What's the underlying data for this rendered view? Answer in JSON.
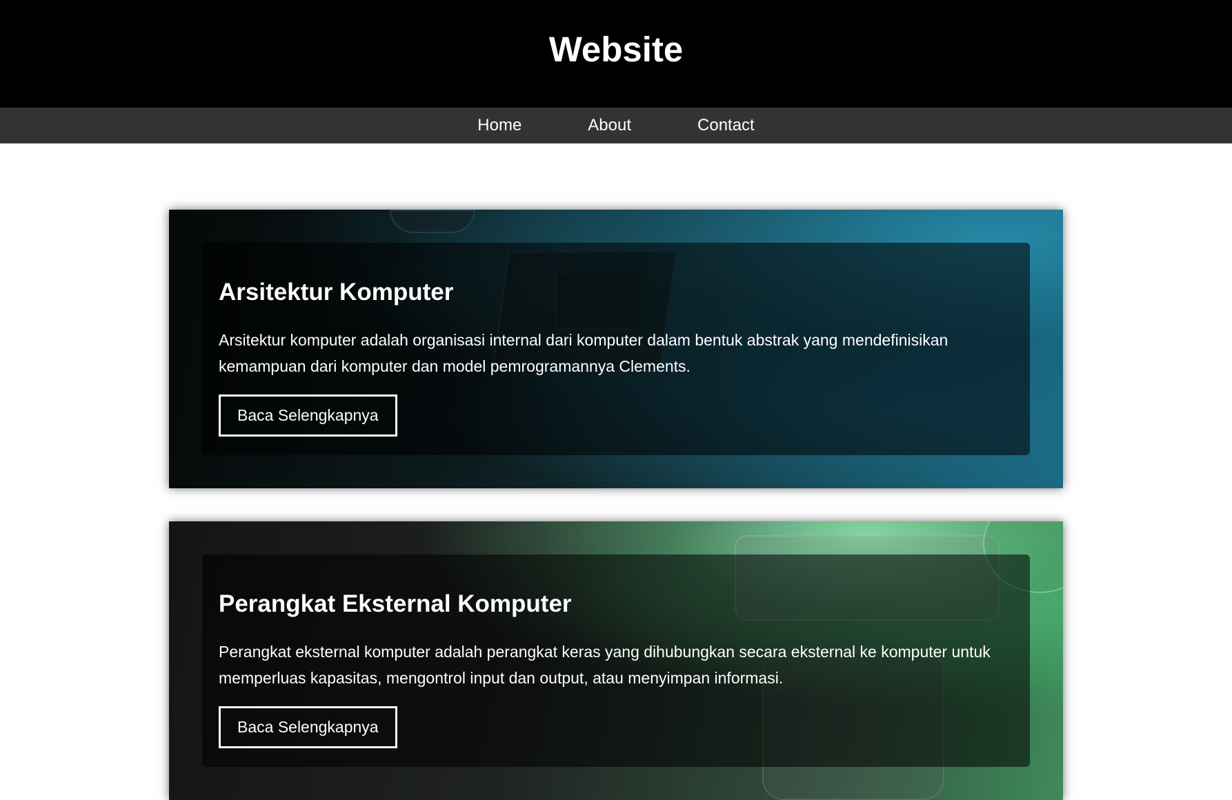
{
  "header": {
    "title": "Website"
  },
  "nav": {
    "items": [
      {
        "label": "Home"
      },
      {
        "label": "About"
      },
      {
        "label": "Contact"
      }
    ]
  },
  "cards": [
    {
      "title": "Arsitektur Komputer",
      "text": "Arsitektur komputer adalah organisasi internal dari komputer dalam bentuk abstrak yang mendefinisikan kemampuan dari komputer dan model pemrogramannya Clements.",
      "button_label": "Baca Selengkapnya",
      "background": "computer-chip-image"
    },
    {
      "title": "Perangkat Eksternal Komputer",
      "text": "Perangkat eksternal komputer adalah perangkat keras yang dihubungkan secara eksternal ke komputer untuk memperluas kapasitas, mengontrol input dan output, atau menyimpan informasi.",
      "button_label": "Baca Selengkapnya",
      "background": "peripheral-devices-image"
    }
  ]
}
